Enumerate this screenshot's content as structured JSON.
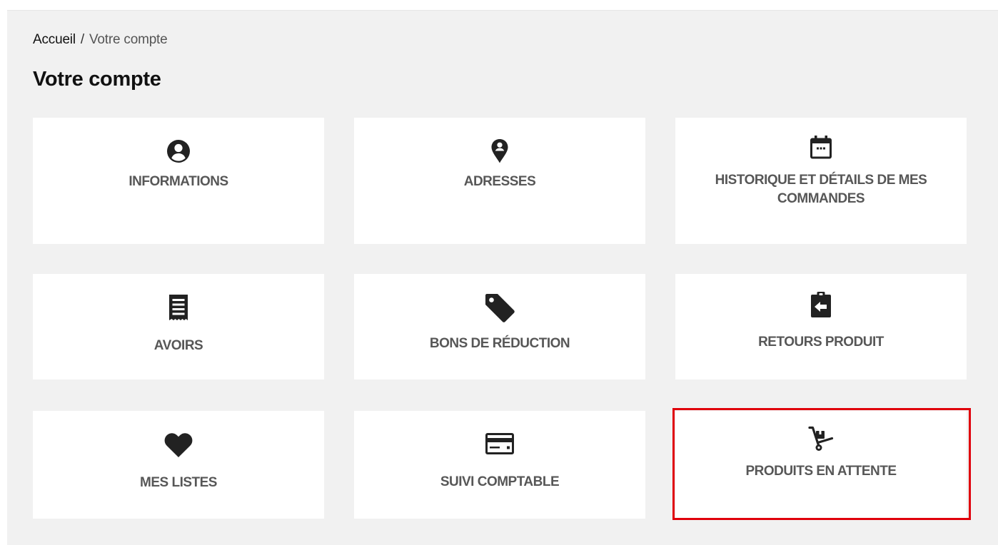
{
  "breadcrumb": {
    "home": "Accueil",
    "separator": "/",
    "current": "Votre compte"
  },
  "page_title": "Votre compte",
  "cards": [
    {
      "label": "INFORMATIONS",
      "icon": "user-circle-icon"
    },
    {
      "label": "ADRESSES",
      "icon": "map-marker-icon"
    },
    {
      "label": "HISTORIQUE ET DÉTAILS DE MES COMMANDES",
      "icon": "calendar-icon"
    },
    {
      "label": "AVOIRS",
      "icon": "receipt-icon"
    },
    {
      "label": "BONS DE RÉDUCTION",
      "icon": "tag-icon"
    },
    {
      "label": "RETOURS PRODUIT",
      "icon": "clipboard-return-icon"
    },
    {
      "label": "MES LISTES",
      "icon": "heart-icon"
    },
    {
      "label": "SUIVI COMPTABLE",
      "icon": "credit-card-icon"
    },
    {
      "label": "PRODUITS EN ATTENTE",
      "icon": "hand-truck-icon"
    }
  ],
  "colors": {
    "page_background": "#f1f1f1",
    "card_background": "#ffffff",
    "icon": "#222222",
    "label": "#575757",
    "highlight": "#e0000b"
  }
}
